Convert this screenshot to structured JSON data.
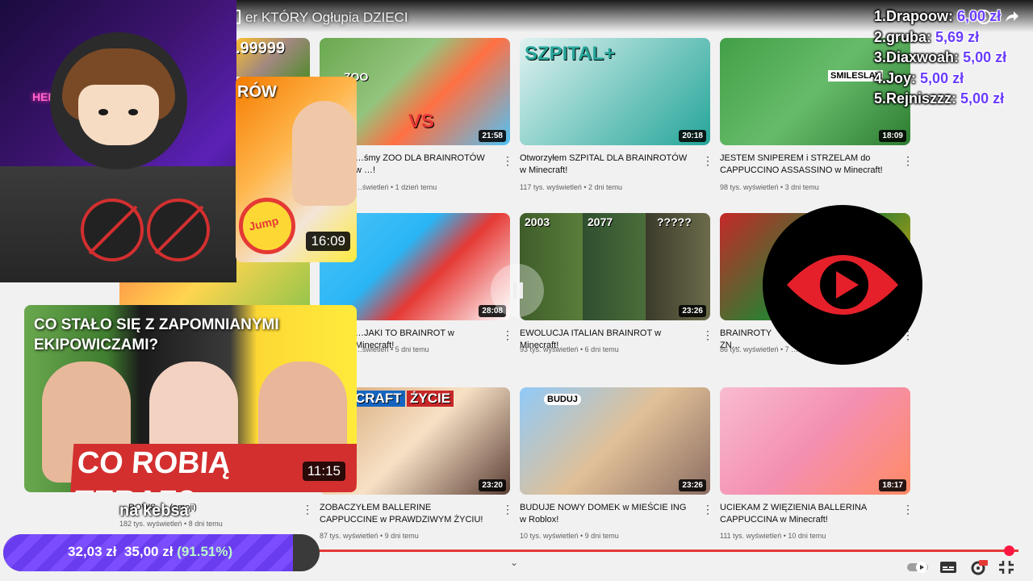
{
  "video": {
    "title": "er KTÓRY Ogłupia DZIECI"
  },
  "donors": [
    {
      "rank": "1.",
      "name": "Drapoow:",
      "amount": "6,00 zł"
    },
    {
      "rank": "2.",
      "name": "gruba:",
      "amount": "5,69 zł"
    },
    {
      "rank": "3.",
      "name": "Diaxwoah:",
      "amount": "5,00 zł"
    },
    {
      "rank": "4.",
      "name": "Joy:",
      "amount": "5,00 zł"
    },
    {
      "rank": "5.",
      "name": "Rejniszzz:",
      "amount": "5,00 zł"
    }
  ],
  "overlay": {
    "caption": "na kebsa",
    "neon_sign": "HELL",
    "goal_current": "32,03 zł",
    "goal_target": "35,00 zł",
    "goal_percent": "(91.51%)",
    "goal_fraction": 0.9151
  },
  "featured": [
    {
      "title_fragment": "RÓW",
      "duration": "16:09",
      "badge": "Jump"
    },
    {
      "title": "CO STAŁO SIĘ Z ZAPOMNIANYMI EKIPOWICZAMI?",
      "banner": "CO ROBIĄ TERAZ?",
      "duration": "11:15"
    }
  ],
  "grid": {
    "row1": [
      {
        "title": "…śmy ZOO DLA BRAINROTÓW w …!",
        "meta": "…świetleń • 1 dzień temu",
        "duration": "21:58",
        "thumb_text": "ZOO",
        "thumb_text2": "VS"
      },
      {
        "title": "Otworzyłem SZPITAL DLA BRAINROTÓW w Minecraft!",
        "meta": "117 tys. wyświetleń • 2 dni temu",
        "duration": "20:18",
        "thumb_text": "SZPITAL+"
      },
      {
        "title": "JESTEM SNIPEREM i STRZELAM do CAPPUCCINO ASSASSINO w Minecraft!",
        "meta": "98 tys. wyświetleń • 3 dni temu",
        "duration": "18:09",
        "thumb_text": "SMILESLAY"
      }
    ],
    "row2": [
      {
        "title": "…JAKI TO BRAINROT w Minecraft!",
        "meta": "…świetleń • 5 dni temu",
        "duration": "28:08"
      },
      {
        "title": "EWOLUCJA ITALIAN BRAINROT w Minecraft!",
        "meta": "93 tys. wyświetleń • 6 dni temu",
        "duration": "23:26",
        "thumb_labels": [
          "2003",
          "2077",
          "?????"
        ]
      },
      {
        "title": "BRAINROTY ZN…",
        "meta": "86 tys. wyświetleń • 7 …"
      }
    ],
    "row3": [
      {
        "title": "ZOBACZYŁEM BALLERINE CAPPUCCINE w PRAWDZIWYM ŻYCIU!",
        "meta": "87 tys. wyświetleń • 9 dni temu",
        "duration": "23:20",
        "thumb_text": "CRAFT",
        "thumb_text2": "ŻYCIE"
      },
      {
        "title": "BUDUJE NOWY DOMEK w MIEŚCIE ING w Roblox!",
        "meta": "10 tys. wyświetleń • 9 dni temu",
        "duration": "23:26",
        "thumb_text": "BUDUJ"
      },
      {
        "title": "UCIEKAM Z WIĘZIENIA BALLERINA CAPPUCCINA w Minecraft!",
        "meta": "111 tys. wyświetleń • 10 dni temu",
        "duration": "18:17"
      }
    ],
    "left_partial": [
      {
        "thumb_text": ".99999"
      },
      {
        "title": "…ROWS … (emoji)",
        "meta": "182 tys. wyświetleń • 8 dni temu"
      }
    ]
  },
  "colors": {
    "accent_red": "#e53935",
    "donor_amount": "#6a3cff",
    "goal_fill": "#7b4dff"
  },
  "icons": [
    "gift-icon",
    "clock-icon",
    "share-icon",
    "autoplay-toggle-icon",
    "subtitles-icon",
    "settings-hd-icon",
    "fullscreen-exit-icon",
    "chevron-down-icon",
    "pause-icon",
    "eye-logo-icon"
  ]
}
